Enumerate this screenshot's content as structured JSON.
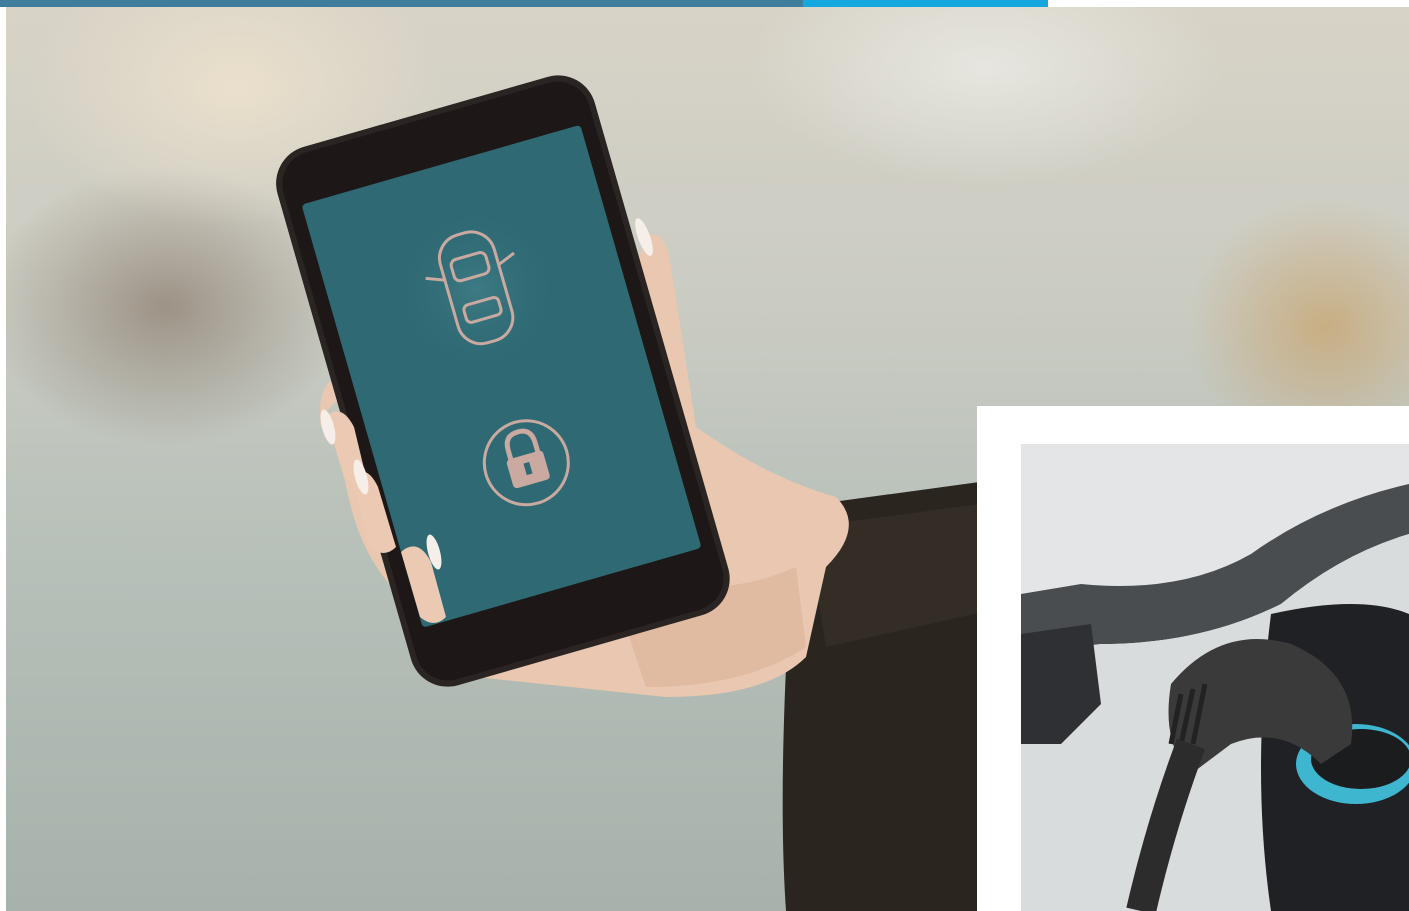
{
  "top_bar": {
    "colors": [
      "#3f7d9c",
      "#14a8de",
      "#ffffff"
    ]
  },
  "main_photo": {
    "phone_screen_icons": [
      "car-topview-icon",
      "lock-icon"
    ],
    "colors": {
      "screen": "#2f6a74",
      "phone_body": "#2a2422",
      "sleeve": "#2b2520",
      "skin": "#e9c7b0"
    }
  },
  "inset_photo": {
    "colors": {
      "car_body": "#e3e5e6",
      "connector": "#3a3a3a",
      "ring": "#3fb6cf"
    }
  }
}
